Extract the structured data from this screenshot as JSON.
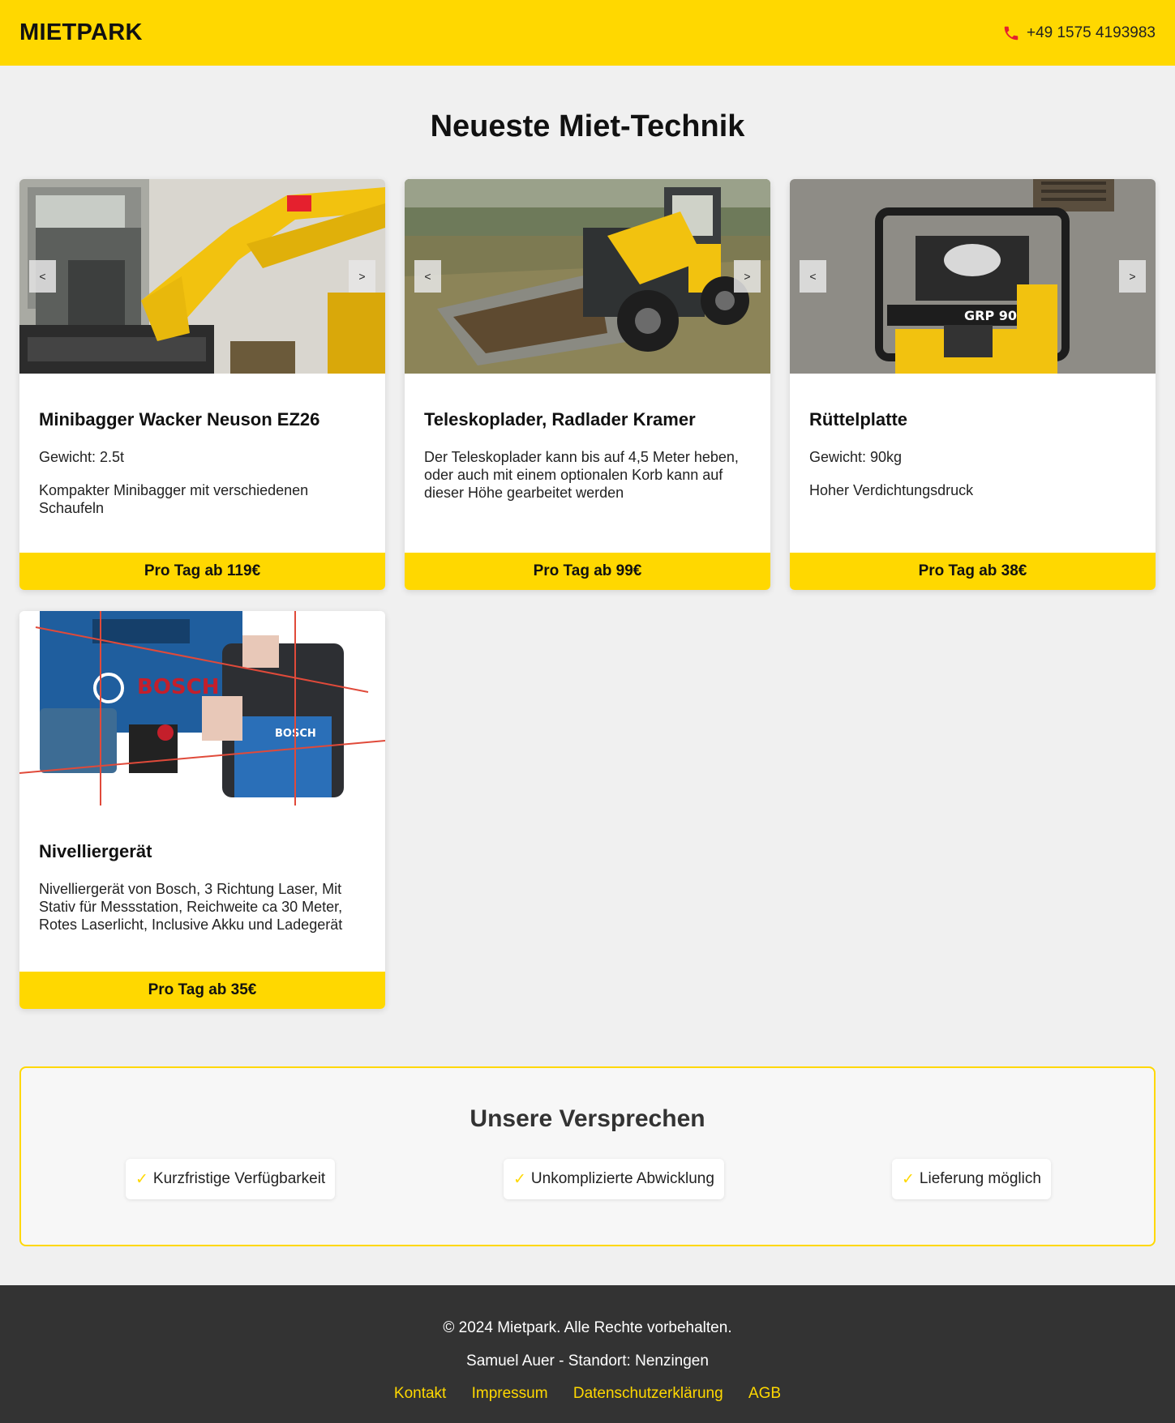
{
  "header": {
    "logo": "MIETPARK",
    "phone": "+49 1575 4193983",
    "phone_icon": "phone-icon",
    "accent_color": "#ffd800"
  },
  "main": {
    "title": "Neueste Miet-Technik",
    "products": [
      {
        "name": "Minibagger Wacker Neuson EZ26",
        "lines": [
          "Gewicht: 2.5t",
          "Kompakter Minibagger mit verschiedenen Schaufeln"
        ],
        "price": "Pro Tag ab 119€",
        "has_carousel": true,
        "prev_label": "<",
        "next_label": ">"
      },
      {
        "name": "Teleskoplader, Radlader Kramer",
        "lines": [
          "Der Teleskoplader kann bis auf 4,5 Meter heben, oder auch mit einem optionalen Korb kann auf dieser Höhe gearbeitet werden"
        ],
        "price": "Pro Tag ab 99€",
        "has_carousel": true,
        "prev_label": "<",
        "next_label": ">"
      },
      {
        "name": "Rüttelplatte",
        "lines": [
          "Gewicht: 90kg",
          "Hoher Verdichtungsdruck"
        ],
        "price": "Pro Tag ab 38€",
        "has_carousel": true,
        "prev_label": "<",
        "next_label": ">"
      },
      {
        "name": "Nivelliergerät",
        "lines": [
          "Nivelliergerät von Bosch, 3 Richtung Laser, Mit Stativ für Messstation, Reichweite ca 30 Meter, Rotes Laserlicht, Inclusive Akku und Ladegerät"
        ],
        "price": "Pro Tag ab 35€",
        "has_carousel": false
      }
    ]
  },
  "promises": {
    "title": "Unsere Versprechen",
    "check_glyph": "✓",
    "items": [
      "Kurzfristige Verfügbarkeit",
      "Unkomplizierte Abwicklung",
      "Lieferung möglich"
    ]
  },
  "footer": {
    "copyright": "© 2024 Mietpark. Alle Rechte vorbehalten.",
    "location": "Samuel Auer - Standort: Nenzingen",
    "links": [
      "Kontakt",
      "Impressum",
      "Datenschutzerklärung",
      "AGB"
    ]
  }
}
